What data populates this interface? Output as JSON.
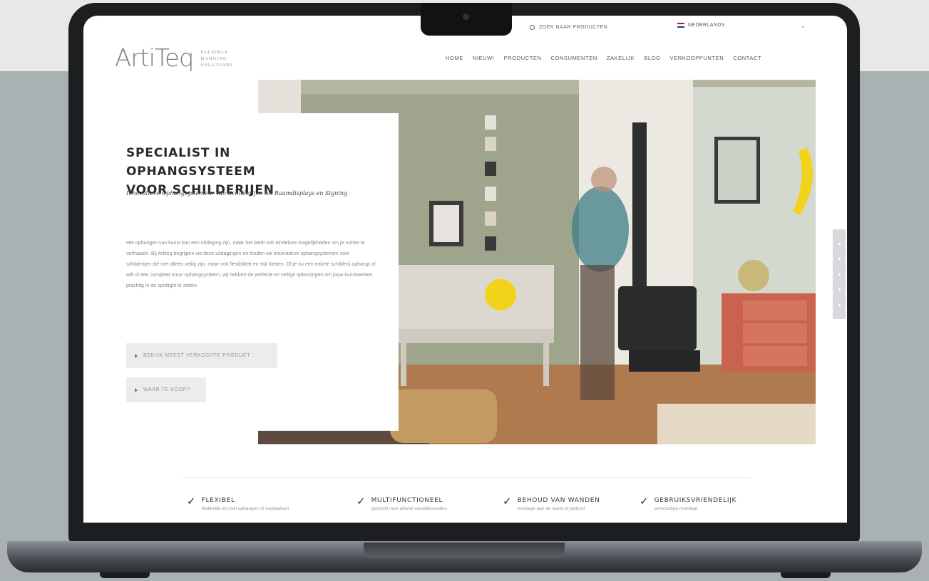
{
  "topbar": {
    "search_label": "ZOEK NAAR PRODUCTEN",
    "language_label": "NEDERLANDS",
    "flag_colors": [
      "#ae1c28",
      "#ffffff",
      "#21468b"
    ]
  },
  "logo": {
    "word": "ArtiTeq",
    "tagline": [
      "FLEXIBLE",
      "HANGING",
      "SOLUTIONS"
    ]
  },
  "nav": {
    "items": [
      "HOME",
      "NIEUW!",
      "PRODUCTEN",
      "CONSUMENTEN",
      "ZAKELIJK",
      "BLOG",
      "VERKOOPPUNTEN",
      "CONTACT"
    ]
  },
  "hero": {
    "title_line1": "SPECIALIST IN OPHANGSYSTEEM",
    "title_line2": "VOOR SCHILDERIJEN",
    "subtitle": "Innovatieve Ophangsystemen: Van Schilderijen tot Raamdisplays en Signing",
    "body": "Het ophangen van kunst kan een uitdaging zijn, maar het biedt ook eindeloze mogelijkheden om je ruimte te verfraaien. Bij Artiteq begrijpen we deze uitdagingen en bieden we innovatieve ophangsystemen voor schilderijen die niet alleen veilig zijn, maar ook flexibiliteit en stijl bieden. Of je nu een enkele schilderij ophangt of wilt of een compleet muur ophangsysteem, wij hebben de perfecte en veilige oplossingen om jouw kunstwerken prachtig in de spotlight te zetten.",
    "button_primary": "BEKIJK MEEST VERKOCHTE PRODUCT",
    "button_secondary": "WAAR TE KOOP?"
  },
  "features": [
    {
      "title": "FLEXIBEL",
      "desc": "Makkelijk en snel ophangen of verplaatsen"
    },
    {
      "title": "MULTIFUNCTIONEEL",
      "desc": "geschikt voor allerlei wanddecoraties"
    },
    {
      "title": "BEHOUD VAN WANDEN",
      "desc": "montage aan de wand of plafond"
    },
    {
      "title": "GEBRUIKSVRIENDELIJK",
      "desc": "eenvoudige montage"
    }
  ],
  "colors": {
    "accent_yellow": "#f2d21a",
    "wall_green": "#9da28c",
    "cabinet_red": "#c9624e"
  },
  "icons": [
    "search-icon",
    "flag-icon",
    "chevron-down-icon",
    "check-icon",
    "triangle-right-icon"
  ]
}
